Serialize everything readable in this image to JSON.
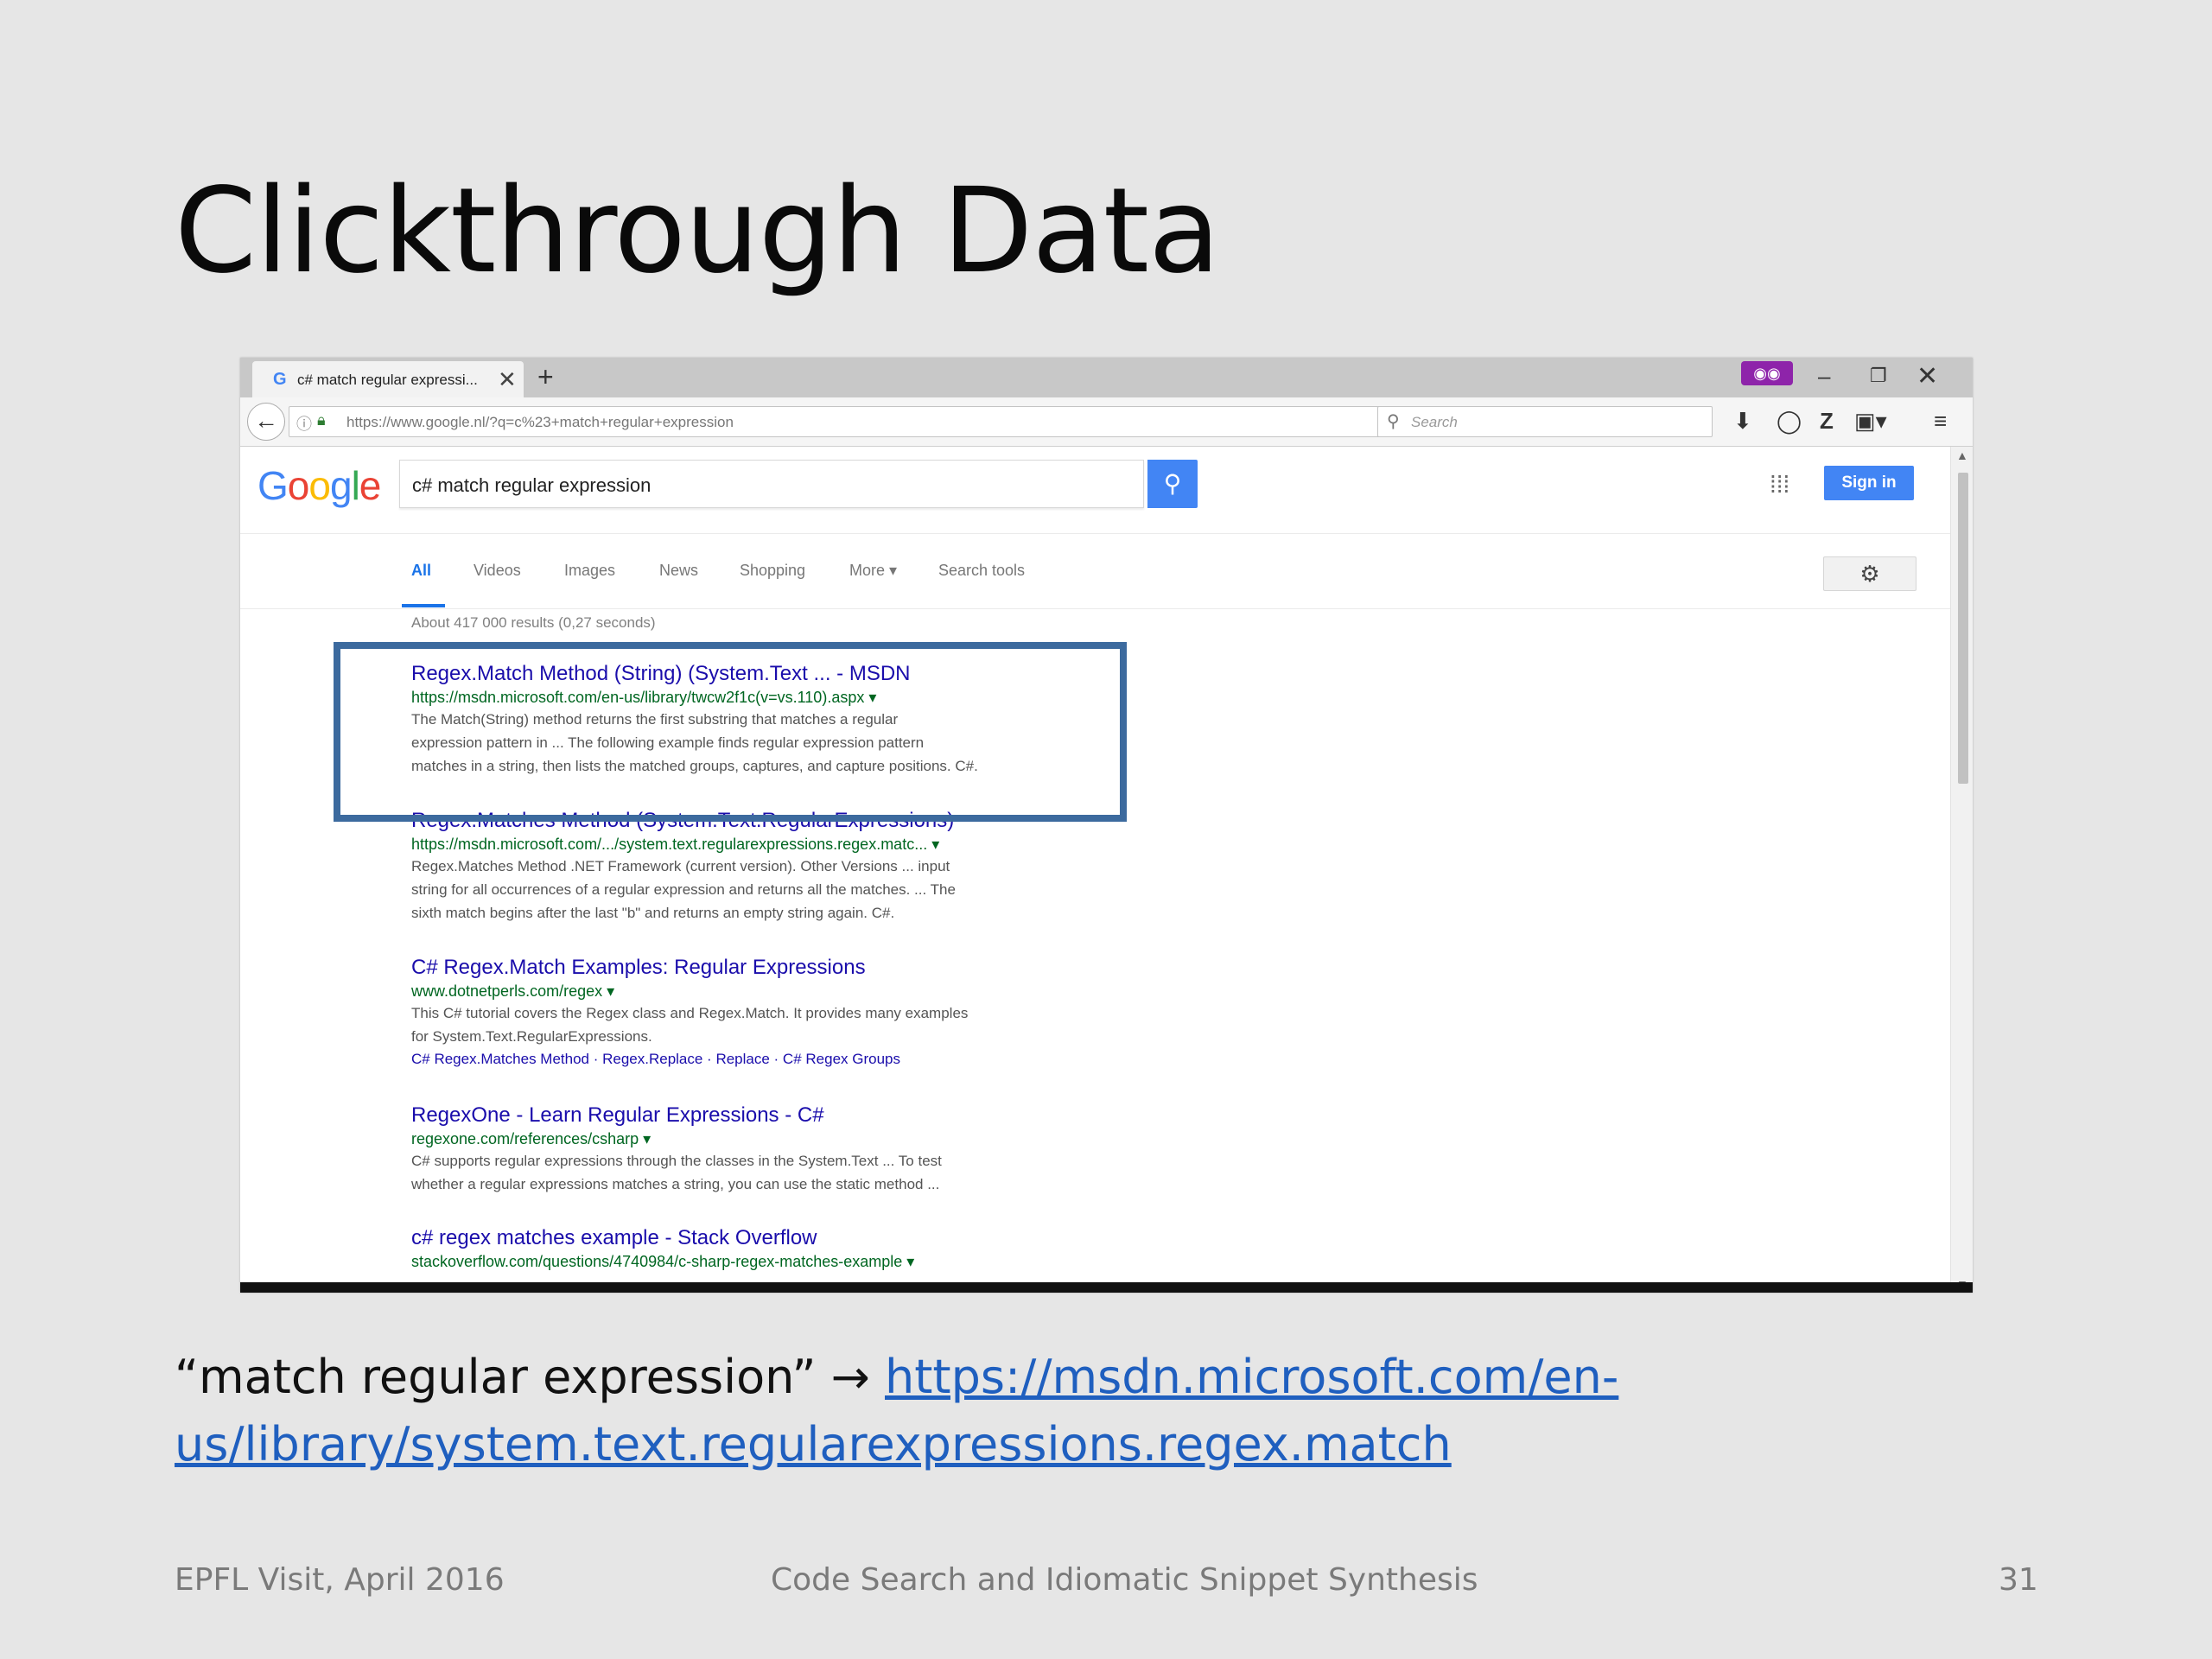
{
  "slide": {
    "title": "Clickthrough Data",
    "caption_query": "“match regular expression” → ",
    "caption_link": "https://msdn.microsoft.com/en-us/library/system.text.regularexpressions.regex.match",
    "footer_left": "EPFL Visit, April 2016",
    "footer_center": "Code Search and Idiomatic Snippet Synthesis",
    "page_number": "31"
  },
  "browser": {
    "tab_title": "c# match regular expressi...",
    "tab_close": "✕",
    "new_tab": "+",
    "url": "https://www.google.nl/?q=c%23+match+regular+expression",
    "search_placeholder": "Search",
    "window_controls": {
      "minimize": "–",
      "restore": "❐",
      "close": "✕"
    }
  },
  "google": {
    "logo": [
      "G",
      "o",
      "o",
      "g",
      "l",
      "e"
    ],
    "query": "c# match regular expression",
    "sign_in": "Sign in",
    "tabs": [
      "All",
      "Videos",
      "Images",
      "News",
      "Shopping",
      "More ▾",
      "Search tools"
    ],
    "stats": "About 417 000 results (0,27 seconds)",
    "results": [
      {
        "title": "Regex.Match Method (String) (System.Text ... - MSDN",
        "url": "https://msdn.microsoft.com/en-us/library/twcw2f1c(v=vs.110).aspx ▾",
        "snippet": [
          "The Match(String) method returns the first substring that matches a regular",
          "expression pattern in ... The following example finds regular expression pattern",
          "matches in a string, then lists the matched groups, captures, and capture positions. C#."
        ]
      },
      {
        "title": "Regex.Matches Method (System.Text.RegularExpressions)",
        "url": "https://msdn.microsoft.com/.../system.text.regularexpressions.regex.matc... ▾",
        "snippet": [
          "Regex.Matches Method .NET Framework (current version). Other Versions ... input",
          "string for all occurrences of a regular expression and returns all the matches. ... The",
          "sixth match begins after the last \"b\" and returns an empty string again. C#."
        ]
      },
      {
        "title": "C# Regex.Match Examples: Regular Expressions",
        "url": "www.dotnetperls.com/regex ▾",
        "snippet": [
          "This C# tutorial covers the Regex class and Regex.Match. It provides many examples",
          "for System.Text.RegularExpressions."
        ],
        "links": "C# Regex.Matches Method · Regex.Replace · Replace · C# Regex Groups"
      },
      {
        "title": "RegexOne - Learn Regular Expressions - C#",
        "url": "regexone.com/references/csharp ▾",
        "snippet": [
          "C# supports regular expressions through the classes in the System.Text ... To test",
          "whether a regular expressions matches a string, you can use the static method ..."
        ]
      },
      {
        "title": "c# regex matches example - Stack Overflow",
        "url": "stackoverflow.com/questions/4740984/c-sharp-regex-matches-example ▾",
        "snippet": []
      }
    ]
  },
  "colors": {
    "google_blue": "#4285f4",
    "result_title": "#1a0dab",
    "result_url": "#006621",
    "highlight": "#3c6a9e"
  }
}
